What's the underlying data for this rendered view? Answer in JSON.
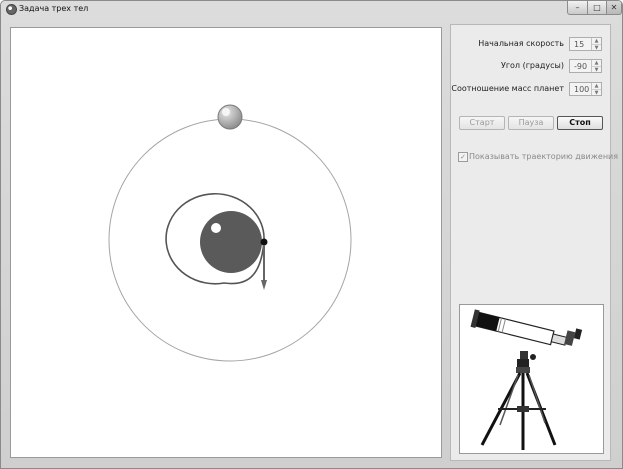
{
  "window": {
    "title": "Задача трех тел",
    "controls": {
      "minimize": "–",
      "maximize": "□",
      "close": "✕"
    }
  },
  "settings": {
    "speed_label": "Начальная скорость",
    "speed_value": "15",
    "angle_label": "Угол (градусы)",
    "angle_value": "-90",
    "mass_ratio_label": "Соотношение масс планет",
    "mass_ratio_value": "100"
  },
  "buttons": {
    "start": "Старт",
    "pause": "Пауза",
    "stop": "Стоп"
  },
  "trajectory_checkbox": {
    "label": "Показывать траекторию движения",
    "checked": true
  },
  "icons": [
    "app-icon",
    "telescope-icon",
    "spin-up-icon",
    "spin-down-icon"
  ],
  "colors": {
    "panel_bg": "#ebebeb",
    "window_bg": "#d5d5d5",
    "planet": "#555555",
    "orbit": "#9a9a9a"
  }
}
